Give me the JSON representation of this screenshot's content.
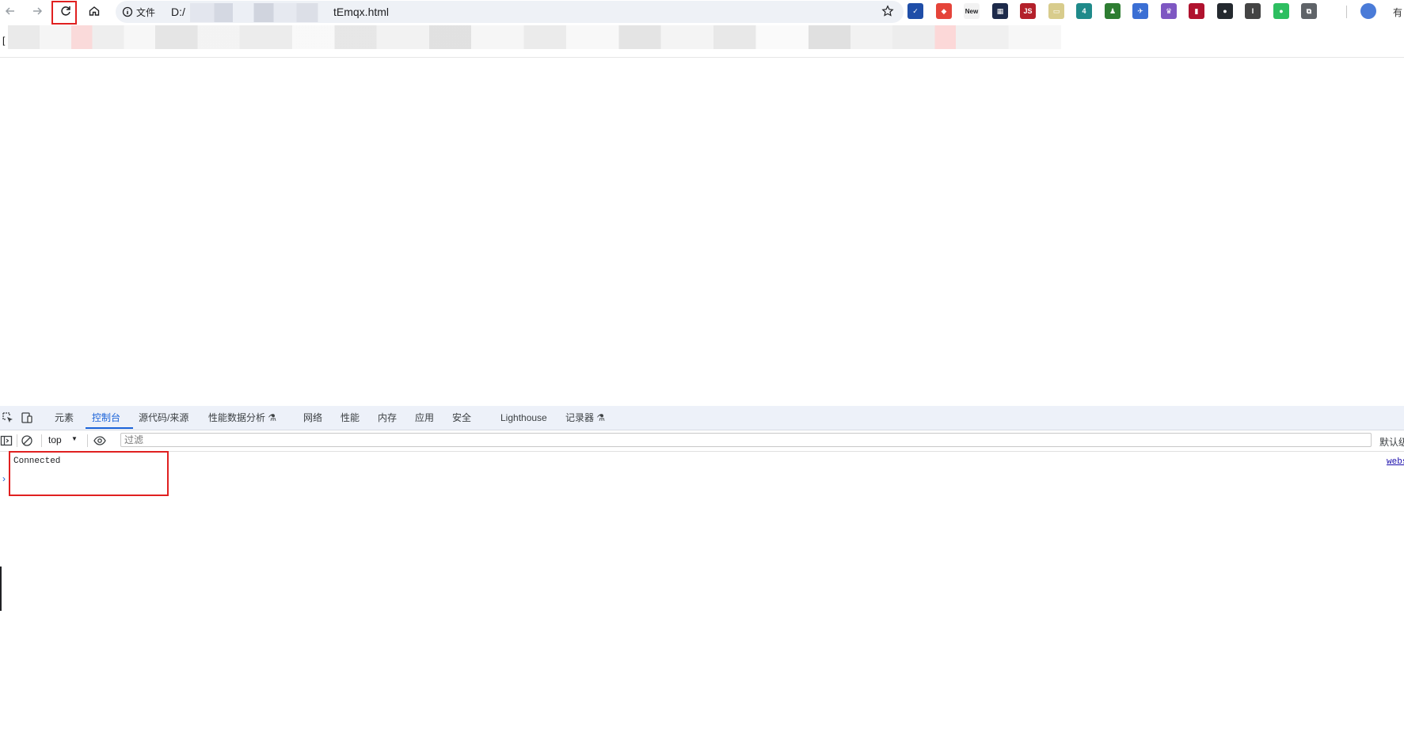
{
  "toolbar": {
    "back_icon": "arrow-left-icon",
    "forward_icon": "arrow-right-icon",
    "reload_icon": "reload-icon",
    "home_icon": "home-icon",
    "site_info_label": "文件",
    "url_prefix": "D:/",
    "url_suffix": "tEmqx.html",
    "extensions": [
      {
        "name": "check-extension-icon",
        "label": "✓",
        "color": "#1f4ea8"
      },
      {
        "name": "dice-extension-icon",
        "label": "◆",
        "color": "#e5443a"
      },
      {
        "name": "new-extension-icon",
        "label": "New",
        "color": "#ffffff"
      },
      {
        "name": "film-extension-icon",
        "label": "▦",
        "color": "#1d2a4a"
      },
      {
        "name": "js-extension-icon",
        "label": "JS",
        "color": "#b3202a"
      },
      {
        "name": "note-extension-icon",
        "label": "▭",
        "color": "#d8cc8c"
      },
      {
        "name": "globe-extension-icon",
        "label": "4",
        "color": "#1f8a8a"
      },
      {
        "name": "user-extension-icon",
        "label": "♟",
        "color": "#2e7d32"
      },
      {
        "name": "plane-extension-icon",
        "label": "✈",
        "color": "#3b6fd4"
      },
      {
        "name": "crown-extension-icon",
        "label": "♛",
        "color": "#7e57c2"
      },
      {
        "name": "bookmark-extension-icon",
        "label": "▮",
        "color": "#b0122e"
      },
      {
        "name": "github-extension-icon",
        "label": "●",
        "color": "#24292f"
      },
      {
        "name": "reader-extension-icon",
        "label": "I",
        "color": "#444444"
      },
      {
        "name": "evernote-extension-icon",
        "label": "●",
        "color": "#2dbe60"
      },
      {
        "name": "puzzle-extension-icon",
        "label": "⧉",
        "color": "#5f6368"
      }
    ],
    "profile_label": "有"
  },
  "page": {
    "bracket": "["
  },
  "devtools": {
    "tabs": [
      {
        "label": "元素",
        "active": false
      },
      {
        "label": "控制台",
        "active": true
      },
      {
        "label": "源代码/来源",
        "active": false
      },
      {
        "label": "性能数据分析 ⚗",
        "active": false
      },
      {
        "label": "网络",
        "active": false
      },
      {
        "label": "性能",
        "active": false
      },
      {
        "label": "内存",
        "active": false
      },
      {
        "label": "应用",
        "active": false
      },
      {
        "label": "安全",
        "active": false
      },
      {
        "label": "Lighthouse",
        "active": false
      },
      {
        "label": "记录器 ⚗",
        "active": false
      }
    ],
    "console": {
      "context": "top",
      "filter_placeholder": "过滤",
      "log_level": "默认级",
      "log_message": "Connected",
      "log_source": "webs",
      "prompt": "›"
    }
  },
  "colors": {
    "highlight": "#e02020",
    "accent": "#1a62d8"
  }
}
